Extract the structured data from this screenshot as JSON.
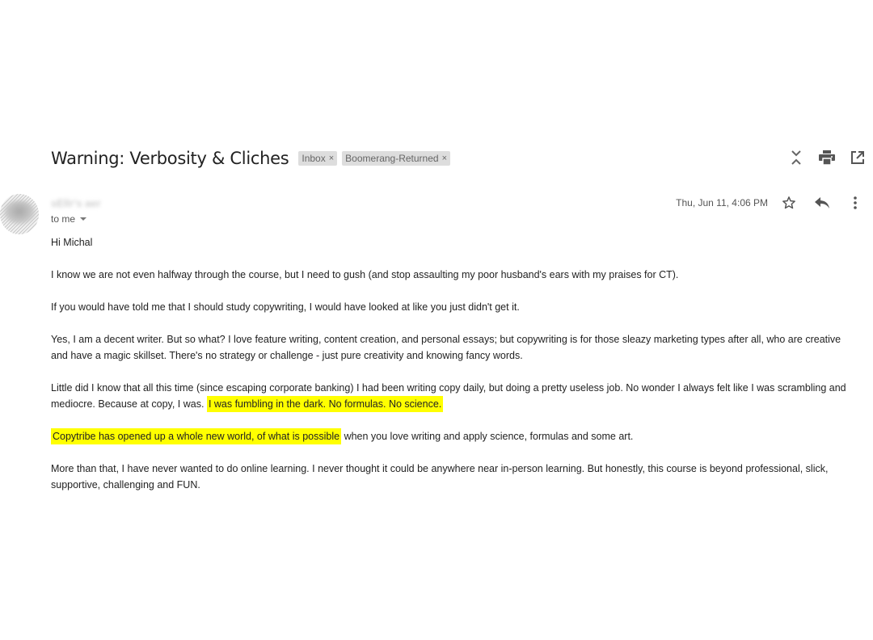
{
  "email": {
    "subject": "Warning: Verbosity & Cliches",
    "labels": [
      {
        "text": "Inbox",
        "close": "×"
      },
      {
        "text": "Boomerang-Returned",
        "close": "×"
      }
    ],
    "sender": "sEllr's aer",
    "recipient": "to me",
    "date": "Thu, Jun 11, 4:06 PM",
    "highlight_color": "#ffff00",
    "body": {
      "greeting": "Hi Michal",
      "p1": "I know we are not even halfway through the course, but I need to gush (and stop assaulting my poor husband's ears with my praises for CT).",
      "p2": "If you would have told me that I should study copywriting, I would have looked at like you just didn't get it.",
      "p3": "Yes, I am a decent writer. But so what? I love feature writing, content creation, and personal essays; but copywriting is for those sleazy marketing types after all, who are creative and have a magic skillset. There's no strategy or challenge - just pure creativity and knowing fancy words.",
      "p4_text": "Little did I know that all this time (since escaping corporate banking) I had been writing copy daily, but doing a pretty useless job. No wonder I always felt like I was scrambling and mediocre. Because at copy, I was.",
      "p4_highlight": "I was fumbling in the dark. No formulas. No science.",
      "p5_highlight": "Copytribe has opened up a whole new world, of what is possible",
      "p5_text": "when you love writing and apply science, formulas and some art.",
      "p6": "More than that, I have never wanted to do online learning. I never thought it could be anywhere near in-person learning. But honestly, this course is beyond professional, slick, supportive, challenging and FUN."
    }
  },
  "icons": {
    "top": [
      "collapse-all-icon",
      "print-icon",
      "open-in-new-window-icon"
    ],
    "message": [
      "star-icon",
      "reply-icon",
      "more-vert-icon"
    ]
  }
}
